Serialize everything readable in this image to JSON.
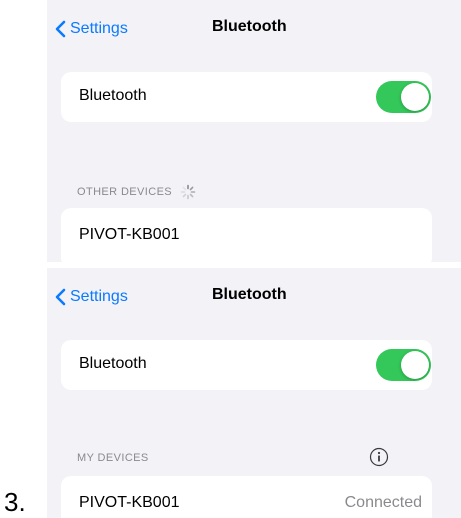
{
  "step_number": "3.",
  "screens": [
    {
      "back_label": "Settings",
      "title": "Bluetooth",
      "bluetooth_label": "Bluetooth",
      "bluetooth_on": true,
      "section_header": "OTHER DEVICES",
      "section_icon": "loading-spinner-icon",
      "device_name": "PIVOT-KB001"
    },
    {
      "back_label": "Settings",
      "title": "Bluetooth",
      "bluetooth_label": "Bluetooth",
      "bluetooth_on": true,
      "section_header": "MY DEVICES",
      "section_icon": "info-icon",
      "device_name": "PIVOT-KB001",
      "device_status": "Connected"
    }
  ],
  "colors": {
    "accent": "#0a7aff",
    "toggle_on": "#34c759",
    "background": "#f2f2f7",
    "secondary_text": "#8a8a8e"
  }
}
